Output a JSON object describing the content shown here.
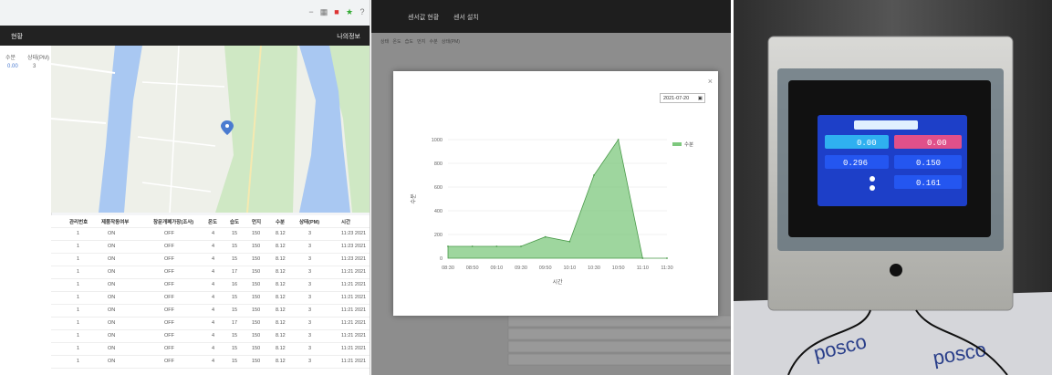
{
  "panel1": {
    "browser_icons": [
      "minus-icon",
      "grid-icon",
      "record-icon",
      "star-icon",
      "question-icon"
    ],
    "appbar_title": "현황",
    "appbar_user": "나의정보",
    "side_headers": [
      "수분",
      "상태(PM)"
    ],
    "side_values": [
      "0.00",
      "3"
    ],
    "table": {
      "columns": [
        "관리번호",
        "제품작동여부",
        "창문개폐가장(조사)",
        "온도",
        "습도",
        "먼지",
        "수분",
        "상태(PM)",
        "시간"
      ],
      "rows": [
        [
          "1",
          "ON",
          "OFF",
          "4",
          "15",
          "150",
          "8.12",
          "3",
          "11:23 2021"
        ],
        [
          "1",
          "ON",
          "OFF",
          "4",
          "15",
          "150",
          "8.12",
          "3",
          "11:23 2021"
        ],
        [
          "1",
          "ON",
          "OFF",
          "4",
          "15",
          "150",
          "8.12",
          "3",
          "11:23 2021"
        ],
        [
          "1",
          "ON",
          "OFF",
          "4",
          "17",
          "150",
          "8.12",
          "3",
          "11:21 2021"
        ],
        [
          "1",
          "ON",
          "OFF",
          "4",
          "16",
          "150",
          "8.12",
          "3",
          "11:21 2021"
        ],
        [
          "1",
          "ON",
          "OFF",
          "4",
          "15",
          "150",
          "8.12",
          "3",
          "11:21 2021"
        ],
        [
          "1",
          "ON",
          "OFF",
          "4",
          "15",
          "150",
          "8.12",
          "3",
          "11:21 2021"
        ],
        [
          "1",
          "ON",
          "OFF",
          "4",
          "17",
          "150",
          "8.12",
          "3",
          "11:21 2021"
        ],
        [
          "1",
          "ON",
          "OFF",
          "4",
          "15",
          "150",
          "8.12",
          "3",
          "11:21 2021"
        ],
        [
          "1",
          "ON",
          "OFF",
          "4",
          "15",
          "150",
          "8.12",
          "3",
          "11:21 2021"
        ],
        [
          "1",
          "ON",
          "OFF",
          "4",
          "15",
          "150",
          "8.12",
          "3",
          "11:21 2021"
        ]
      ]
    }
  },
  "panel2": {
    "bg_tabs": [
      "센서값 현황",
      "센서 설치"
    ],
    "bg_header": [
      "상태",
      "온도",
      "습도",
      "먼지",
      "수분",
      "상태(PM)"
    ],
    "modal": {
      "date_value": "2021-07-20",
      "close_label": "×"
    }
  },
  "chart_data": {
    "type": "area",
    "legend": [
      "수분"
    ],
    "legend_position": "top-right",
    "xlabel": "시간",
    "ylabel": "수분",
    "ylim": [
      0,
      1000
    ],
    "yticks": [
      "0",
      "200",
      "400",
      "600",
      "800",
      "1000"
    ],
    "x": [
      "08:30",
      "08:50",
      "09:10",
      "09:30",
      "09:50",
      "10:10",
      "10:30",
      "10:50",
      "11:10",
      "11:30"
    ],
    "series": [
      {
        "name": "수분",
        "values": [
          100,
          100,
          100,
          100,
          180,
          140,
          700,
          1000,
          0,
          0
        ]
      }
    ],
    "grid": true,
    "color": "#7dc87d"
  },
  "panel3": {
    "screen_values": [
      "0.00",
      "0.00",
      "0.296",
      "0.150",
      "0.161"
    ]
  }
}
